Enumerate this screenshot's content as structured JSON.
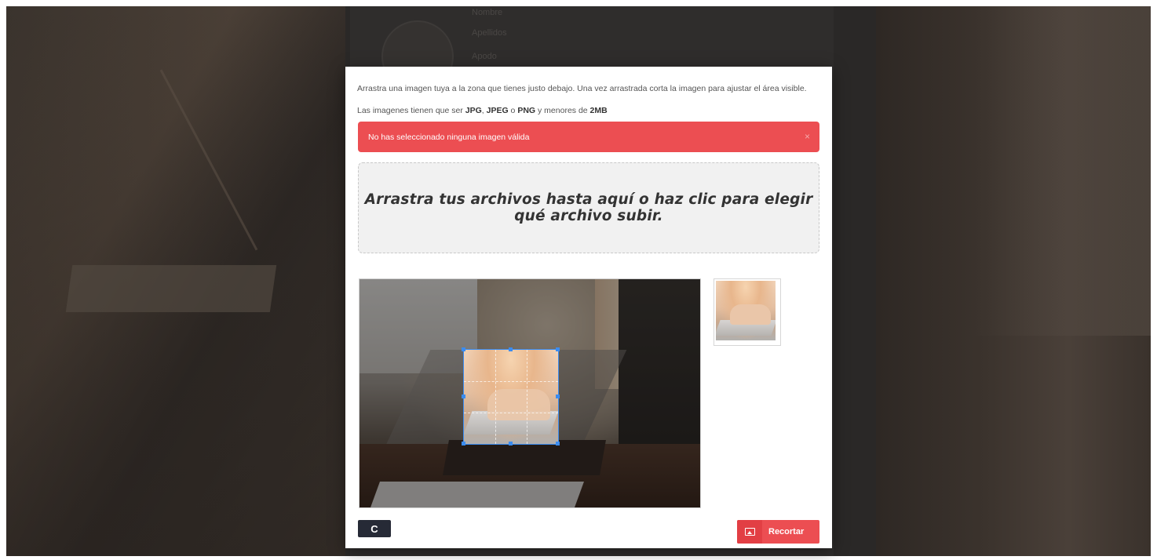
{
  "background": {
    "form_labels": [
      "Nombre",
      "Apellidos",
      "Apodo"
    ]
  },
  "modal": {
    "intro_text": "Arrastra una imagen tuya a la zona que tienes justo debajo. Una vez arrastrada corta la imagen para ajustar el área visible.",
    "requirements": {
      "prefix": "Las imagenes tienen que ser ",
      "format1": "JPG",
      "sep1": ", ",
      "format2": "JPEG",
      "sep2": " o ",
      "format3": "PNG",
      "middle": " y menores de ",
      "max_size": "2MB"
    },
    "alert": {
      "message": "No has seleccionado ninguna imagen válida",
      "close": "×",
      "color": "#ec4e52"
    },
    "dropzone_text": "Arrastra tus archivos hasta aquí o haz clic para elegir qué archivo subir.",
    "reset_button_icon": "C",
    "crop_button_label": "Recortar",
    "crop_button_icon": "image-icon",
    "accent_color": "#3b8cf0"
  }
}
